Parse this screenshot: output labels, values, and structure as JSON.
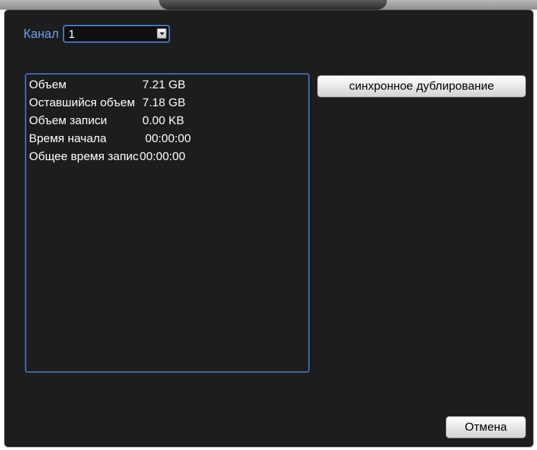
{
  "channel": {
    "label": "Канал",
    "selected": "1"
  },
  "info": {
    "rows": [
      {
        "label": "Объем",
        "value": "7.21 GB"
      },
      {
        "label": "Оставшийся объем",
        "value": "7.18 GB"
      },
      {
        "label": "Объем записи",
        "value": "0.00 KB"
      },
      {
        "label": "Время начала",
        "value": "00:00:00"
      },
      {
        "label": "Общее время записи",
        "value": "00:00:00"
      }
    ]
  },
  "buttons": {
    "sync_label": "синхронное дублирование",
    "cancel_label": "Отмена"
  },
  "colors": {
    "panel_bg": "#1d1d1d",
    "accent_border": "#3e6fb8",
    "label_blue": "#6aa0e8"
  }
}
